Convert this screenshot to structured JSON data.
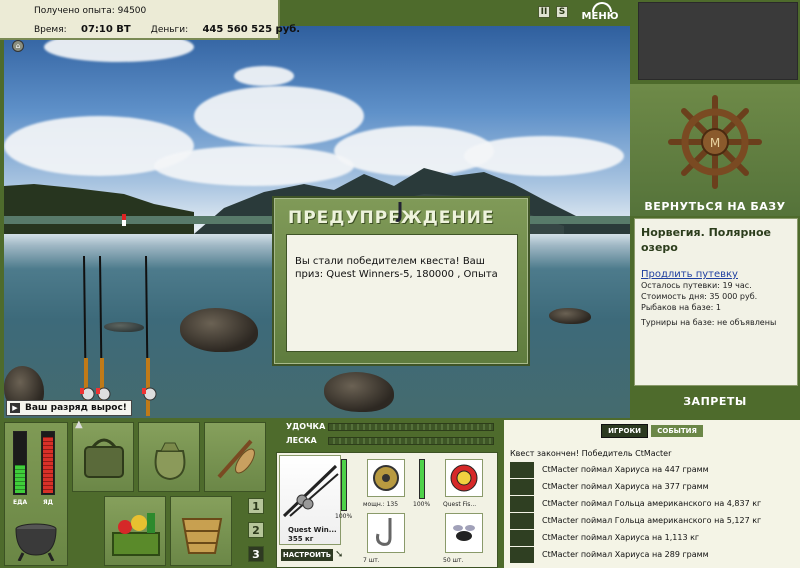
{
  "status": {
    "xp_label": "Получено опыта:",
    "xp_value": "94500",
    "time_label": "Время:",
    "time_value": "07:10 ВТ",
    "money_label": "Деньги:",
    "money_value": "445 560 525 руб."
  },
  "topbar": {
    "btn_pause": "II",
    "btn_sound": "S",
    "menu_label": "МЕНЮ"
  },
  "dialog": {
    "title": "ПРЕДУПРЕЖДЕНИЕ",
    "message": "Вы стали победителем квеста! Ваш приз: Quest Winners-5, 180000 , Опыта"
  },
  "rank_notice": "Ваш разряд вырос!",
  "right_panel": {
    "back_to_base": "ВЕРНУТЬСЯ НА БАЗУ",
    "location": "Норвегия. Полярное озеро",
    "extend_link": "Продлить путевку",
    "remaining": "Осталось путевки: 19 час.",
    "day_cost": "Стоимость дня: 35 000 руб.",
    "fishers": "Рыбаков на базе: 1",
    "tournaments": "Турниры на базе: не объявлены",
    "bans": "ЗАПРЕТЫ"
  },
  "meters": {
    "food_label": "ЕДА",
    "food_level": 0.45,
    "poison_label": "ЯД",
    "poison_level": 0.9
  },
  "inventory_pages": [
    "1",
    "2",
    "3"
  ],
  "rod_panel": {
    "rod_label": "УДОЧКА",
    "line_label": "ЛЕСКА",
    "rod_name": "Quest Win...",
    "rod_weight": "355 кг",
    "rod_percent": "100%",
    "reel_power": "мощн.: 135",
    "reel_percent": "100%",
    "line_name": "Quest Fis...",
    "hooks_count": "7 шт.",
    "bait_count": "50 шт.",
    "setup_button": "НАСТРОИТЬ",
    "rod_level": 1.0,
    "reel_level": 1.0
  },
  "events": {
    "tab_players": "ИГРОКИ",
    "tab_events": "СОБЫТИЯ",
    "header": "Квест закончен! Победитель CtMacter",
    "items": [
      "CtMacter поймал Хариуса на 447 грамм",
      "CtMacter поймал Хариуса на 377 грамм",
      "CtMacter поймал Гольца американского на 4,837 кг",
      "CtMacter поймал Гольца американского на 5,127 кг",
      "CtMacter поймал Хариуса на 1,113 кг",
      "CtMacter поймал Хариуса на 289 грамм"
    ]
  }
}
